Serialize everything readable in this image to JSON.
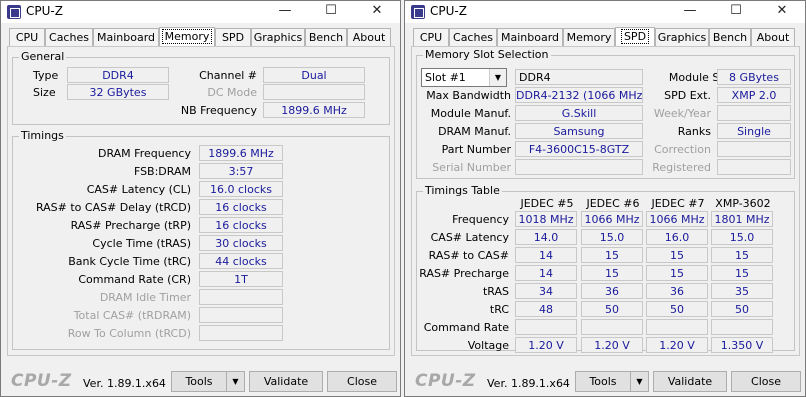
{
  "left": {
    "title": "CPU-Z",
    "tabs": [
      "CPU",
      "Caches",
      "Mainboard",
      "Memory",
      "SPD",
      "Graphics",
      "Bench",
      "About"
    ],
    "general": {
      "heading": "General",
      "type_label": "Type",
      "type_value": "DDR4",
      "size_label": "Size",
      "size_value": "32 GBytes",
      "channel_label": "Channel #",
      "channel_value": "Dual",
      "dc_mode_label": "DC Mode",
      "nb_freq_label": "NB Frequency",
      "nb_freq_value": "1899.6 MHz"
    },
    "timings": {
      "heading": "Timings",
      "rows": [
        {
          "label": "DRAM Frequency",
          "value": "1899.6 MHz"
        },
        {
          "label": "FSB:DRAM",
          "value": "3:57"
        },
        {
          "label": "CAS# Latency (CL)",
          "value": "16.0 clocks"
        },
        {
          "label": "RAS# to CAS# Delay (tRCD)",
          "value": "16 clocks"
        },
        {
          "label": "RAS# Precharge (tRP)",
          "value": "16 clocks"
        },
        {
          "label": "Cycle Time (tRAS)",
          "value": "30 clocks"
        },
        {
          "label": "Bank Cycle Time (tRC)",
          "value": "44 clocks"
        },
        {
          "label": "Command Rate (CR)",
          "value": "1T"
        },
        {
          "label": "DRAM Idle Timer",
          "value": ""
        },
        {
          "label": "Total CAS# (tRDRAM)",
          "value": ""
        },
        {
          "label": "Row To Column (tRCD)",
          "value": ""
        }
      ]
    },
    "footer": {
      "logo": "CPU-Z",
      "version": "Ver. 1.89.1.x64",
      "tools": "Tools",
      "validate": "Validate",
      "close": "Close"
    }
  },
  "right": {
    "title": "CPU-Z",
    "tabs": [
      "CPU",
      "Caches",
      "Mainboard",
      "Memory",
      "SPD",
      "Graphics",
      "Bench",
      "About"
    ],
    "slot": {
      "heading": "Memory Slot Selection",
      "selected": "Slot #1",
      "type_value": "DDR4",
      "module_size_label": "Module Size",
      "module_size_value": "8 GBytes",
      "max_bw_label": "Max Bandwidth",
      "max_bw_value": "DDR4-2132 (1066 MHz)",
      "spd_ext_label": "SPD Ext.",
      "spd_ext_value": "XMP 2.0",
      "module_manuf_label": "Module Manuf.",
      "module_manuf_value": "G.Skill",
      "week_year_label": "Week/Year",
      "dram_manuf_label": "DRAM Manuf.",
      "dram_manuf_value": "Samsung",
      "ranks_label": "Ranks",
      "ranks_value": "Single",
      "part_number_label": "Part Number",
      "part_number_value": "F4-3600C15-8GTZ",
      "correction_label": "Correction",
      "serial_label": "Serial Number",
      "registered_label": "Registered"
    },
    "timings_table": {
      "heading": "Timings Table",
      "columns": [
        "JEDEC #5",
        "JEDEC #6",
        "JEDEC #7",
        "XMP-3602"
      ],
      "rows": [
        {
          "label": "Frequency",
          "values": [
            "1018 MHz",
            "1066 MHz",
            "1066 MHz",
            "1801 MHz"
          ]
        },
        {
          "label": "CAS# Latency",
          "values": [
            "14.0",
            "15.0",
            "16.0",
            "15.0"
          ]
        },
        {
          "label": "RAS# to CAS#",
          "values": [
            "14",
            "15",
            "15",
            "15"
          ]
        },
        {
          "label": "RAS# Precharge",
          "values": [
            "14",
            "15",
            "15",
            "15"
          ]
        },
        {
          "label": "tRAS",
          "values": [
            "34",
            "36",
            "36",
            "35"
          ]
        },
        {
          "label": "tRC",
          "values": [
            "48",
            "50",
            "50",
            "50"
          ]
        },
        {
          "label": "Command Rate",
          "values": [
            "",
            "",
            "",
            ""
          ]
        },
        {
          "label": "Voltage",
          "values": [
            "1.20 V",
            "1.20 V",
            "1.20 V",
            "1.350 V"
          ]
        }
      ]
    },
    "footer": {
      "logo": "CPU-Z",
      "version": "Ver. 1.89.1.x64",
      "tools": "Tools",
      "validate": "Validate",
      "close": "Close"
    }
  }
}
